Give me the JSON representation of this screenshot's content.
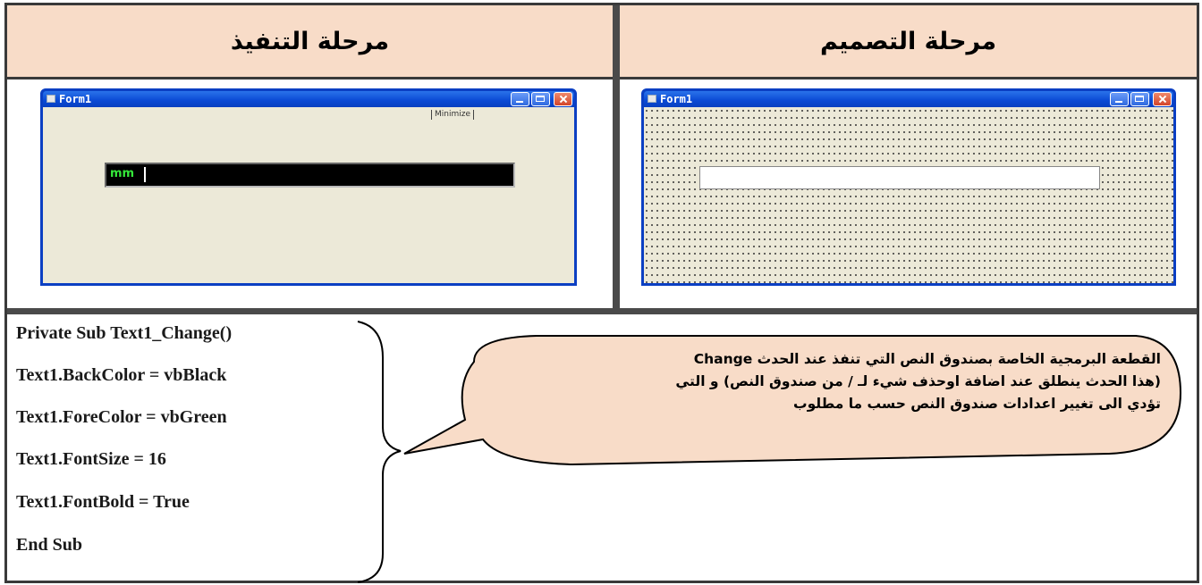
{
  "headers": {
    "execution_stage": "مرحلة التنفيذ",
    "design_stage": "مرحلة التصميم"
  },
  "run_window": {
    "title": "Form1",
    "minimize_label": "Minimize",
    "textbox_value": "mm",
    "textbox_bg": "#000000",
    "textbox_fg": "#35e83a"
  },
  "design_window": {
    "title": "Form1"
  },
  "code_lines": [
    "Private Sub Text1_Change()",
    "Text1.BackColor = vbBlack",
    "Text1.ForeColor = vbGreen",
    "Text1.FontSize = 16",
    "Text1.FontBold = True",
    "End Sub"
  ],
  "callout": {
    "line1": "القطعة البرمجية الخاصة بصندوق النص التي تنفذ عند الحدث Change",
    "line2": "(هذا الحدث ينطلق عند اضافة اوحذف شيء لـ / من صندوق النص) و التي",
    "line3": "تؤدي الى تغيير  اعدادات صندوق النص حسب ما مطلوب"
  },
  "colors": {
    "header_bg": "#f8dcc8",
    "callout_bg": "#f8dcc8",
    "xp_titlebar": "#0a49d4",
    "form_bg": "#ece9d8"
  }
}
